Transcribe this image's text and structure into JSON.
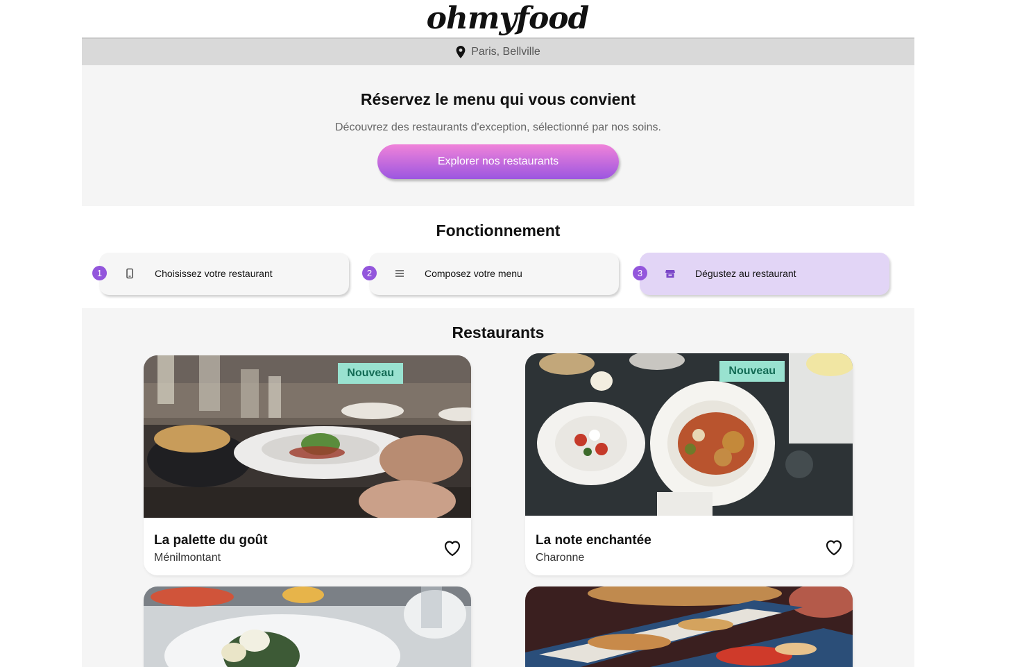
{
  "header": {
    "brand": "ohmyfood",
    "location": "Paris, Bellville"
  },
  "hero": {
    "title": "Réservez le menu qui vous convient",
    "subtitle": "Découvrez des restaurants d'exception, sélectionné par nos soins.",
    "cta_label": "Explorer nos restaurants"
  },
  "how_it_works": {
    "title": "Fonctionnement",
    "steps": [
      {
        "number": "1",
        "icon": "mobile-phone-icon",
        "label": "Choisissez votre restaurant"
      },
      {
        "number": "2",
        "icon": "list-icon",
        "label": "Composez votre menu"
      },
      {
        "number": "3",
        "icon": "store-icon",
        "label": "Dégustez au restaurant"
      }
    ]
  },
  "restaurants": {
    "title": "Restaurants",
    "items": [
      {
        "name": "La palette du goût",
        "area": "Ménilmontant",
        "badge": "Nouveau"
      },
      {
        "name": "La note enchantée",
        "area": "Charonne",
        "badge": "Nouveau"
      },
      {
        "name": "",
        "area": "",
        "badge": ""
      },
      {
        "name": "",
        "area": "",
        "badge": ""
      }
    ]
  },
  "colors": {
    "accent": "#9356dc",
    "cta_top": "#f083d9",
    "cta_bottom": "#9c56e0",
    "badge_bg": "#99e2d0",
    "badge_text": "#136b55",
    "active_step_bg": "#e2d5f6"
  }
}
